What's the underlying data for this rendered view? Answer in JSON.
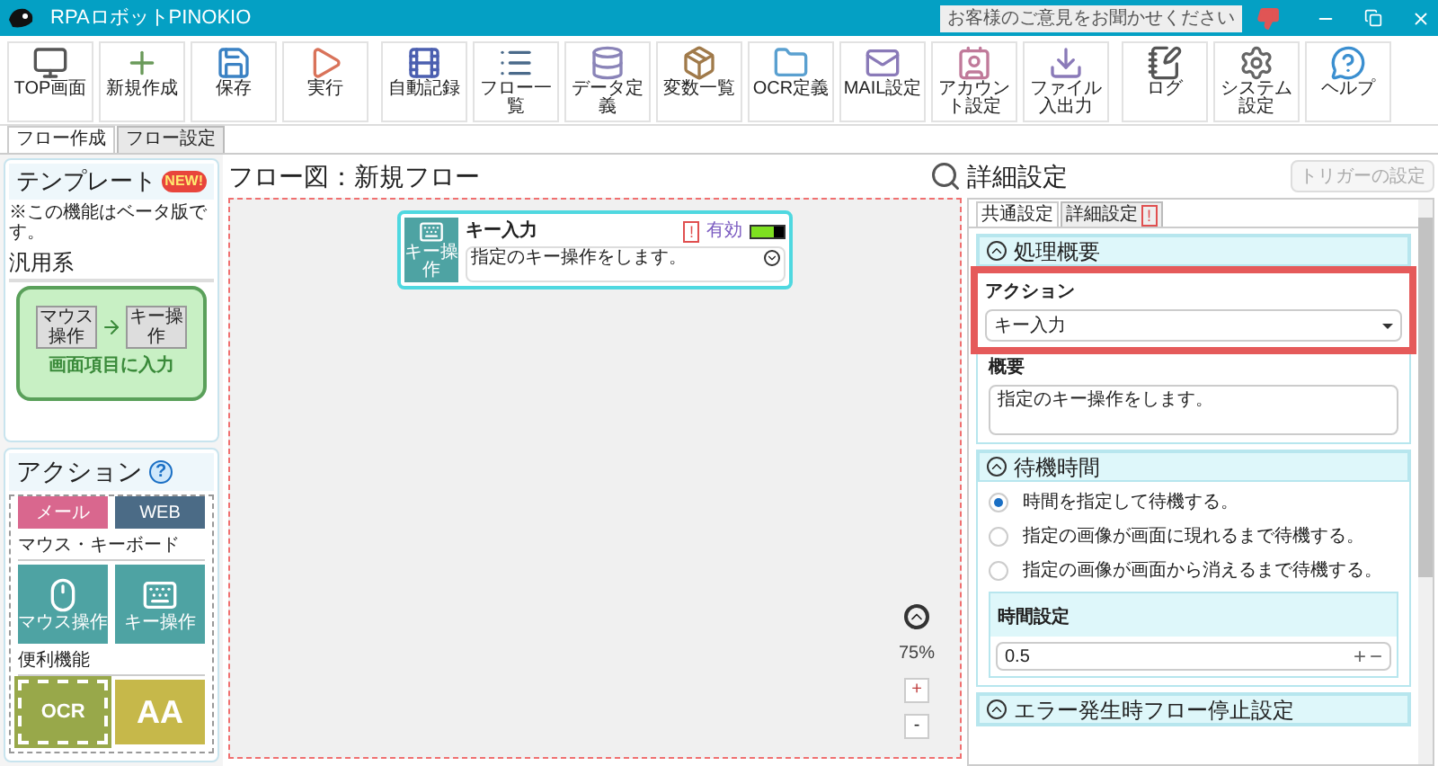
{
  "window": {
    "title": "RPAロボットPINOKIO",
    "feedback": "お客様のご意見をお聞かせください"
  },
  "toolbar": [
    {
      "label": "TOP画面",
      "kind": "top"
    },
    {
      "label": "新規作成",
      "kind": "new"
    },
    {
      "label": "保存",
      "kind": "save"
    },
    {
      "label": "実行",
      "kind": "run"
    },
    {
      "label": "自動記録",
      "kind": "record"
    },
    {
      "label": "フロー一覧",
      "kind": "list"
    },
    {
      "label": "データ定義",
      "kind": "data"
    },
    {
      "label": "変数一覧",
      "kind": "vars"
    },
    {
      "label": "OCR定義",
      "kind": "ocr"
    },
    {
      "label": "MAIL設定",
      "kind": "mail"
    },
    {
      "label": "アカウント設定",
      "kind": "account"
    },
    {
      "label": "ファイル入出力",
      "kind": "file"
    },
    {
      "label": "ログ",
      "kind": "log"
    },
    {
      "label": "システム設定",
      "kind": "system"
    },
    {
      "label": "ヘルプ",
      "kind": "help"
    }
  ],
  "main_tabs": [
    {
      "label": "フロー作成",
      "selected": true
    },
    {
      "label": "フロー設定",
      "selected": false
    }
  ],
  "templates": {
    "title": "テンプレート",
    "badge": "NEW!",
    "note": "※この機能はベータ版です。",
    "category": "汎用系",
    "card": {
      "from": "マウス操作",
      "to": "キー操作",
      "label": "画面項目に入力"
    }
  },
  "actions": {
    "title": "アクション",
    "help": "?",
    "groups": [
      {
        "items": [
          {
            "label": "メール",
            "kind": "text",
            "color": "#d9678e"
          },
          {
            "label": "WEB",
            "kind": "text",
            "color": "#4b6b86"
          }
        ]
      },
      {
        "title": "マウス・キーボード",
        "items": [
          {
            "label": "マウス操作",
            "kind": "mouse",
            "color": "#4ea3a3"
          },
          {
            "label": "キー操作",
            "kind": "keyboard",
            "color": "#4ea3a3"
          }
        ]
      },
      {
        "title": "便利機能",
        "items": [
          {
            "label": "OCR",
            "kind": "ocr",
            "color": "#98a84a"
          },
          {
            "label": "AA",
            "kind": "font",
            "color": "#c6b84a"
          }
        ]
      }
    ]
  },
  "flow": {
    "title": "フロー図：新規フロー",
    "zoom": "75%",
    "zoom_in": "+",
    "zoom_out": "-",
    "nodes": [
      {
        "title": "キー入力",
        "icon_label": "キー操作",
        "warning": "!",
        "status": "有効",
        "enabled": true,
        "description": "指定のキー操作をします。"
      }
    ]
  },
  "details": {
    "title": "詳細設定",
    "trigger_button": {
      "label": "トリガーの設定",
      "disabled": true
    },
    "tabs": [
      {
        "label": "共通設定",
        "selected": true
      },
      {
        "label": "詳細設定",
        "selected": false,
        "warning": "!"
      }
    ],
    "summary": {
      "title": "処理概要",
      "action_label": "アクション",
      "action_value": "キー入力",
      "highlighted": true,
      "overview_label": "概要",
      "overview_value": "指定のキー操作をします。"
    },
    "wait": {
      "title": "待機時間",
      "options": [
        {
          "label": "時間を指定して待機する。",
          "selected": true
        },
        {
          "label": "指定の画像が画面に現れるまで待機する。",
          "selected": false
        },
        {
          "label": "指定の画像が画面から消えるまで待機する。",
          "selected": false
        }
      ],
      "time_label": "時間設定",
      "time_value": "0.5",
      "plus": "+",
      "minus": "−"
    },
    "error": {
      "title": "エラー発生時フロー停止設定"
    }
  }
}
